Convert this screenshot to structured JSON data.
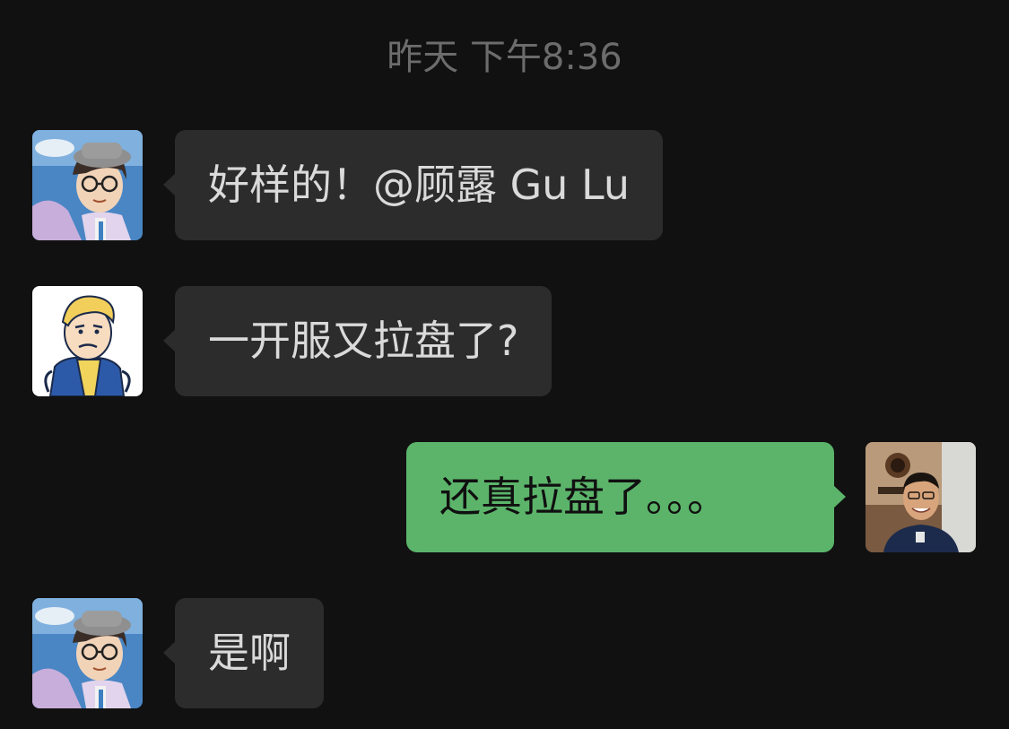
{
  "chat": {
    "timestamp": "昨天 下午8:36",
    "messages": [
      {
        "sender": "other",
        "avatar": "anime-boy-glasses-avatar",
        "text": "好样的！@顾露 Gu Lu"
      },
      {
        "sender": "other",
        "avatar": "vault-boy-avatar",
        "text": "一开服又拉盘了?"
      },
      {
        "sender": "self",
        "avatar": "smiling-man-photo-avatar",
        "text": "还真拉盘了。。。"
      },
      {
        "sender": "other",
        "avatar": "anime-boy-glasses-avatar",
        "text": "是啊"
      }
    ]
  },
  "colors": {
    "background": "#111111",
    "incoming_bubble": "#2c2c2c",
    "outgoing_bubble": "#5bb46a",
    "timestamp_text": "#6c6c6c"
  }
}
